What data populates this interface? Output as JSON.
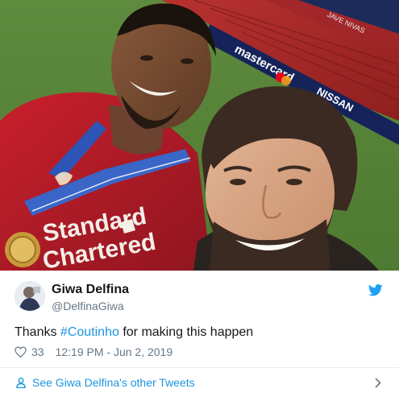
{
  "photo": {
    "banner_text_top": "JAVE NIVAS",
    "banner_text_mastercard": "mastercard",
    "banner_text_nissan": "NISSAN",
    "shirt_sponsor_line1": "Standard",
    "shirt_sponsor_line2": "Chartered"
  },
  "tweet": {
    "author": {
      "display_name": "Giwa Delfina",
      "handle": "@DelfinaGiwa"
    },
    "text_before": "Thanks ",
    "hashtag": "#Coutinho",
    "text_after": " for making this happen",
    "like_count": "33",
    "timestamp": "12:19 PM - Jun 2, 2019",
    "more_tweets_label": "See Giwa Delfina's other Tweets"
  },
  "colors": {
    "link": "#1b95e0",
    "muted": "#657786",
    "text": "#14171a",
    "twitter_blue": "#1da1f2"
  },
  "icons": {
    "brand": "twitter-bird-icon",
    "like": "heart-icon",
    "more": "person-icon",
    "chevron": "chevron-right-icon"
  }
}
